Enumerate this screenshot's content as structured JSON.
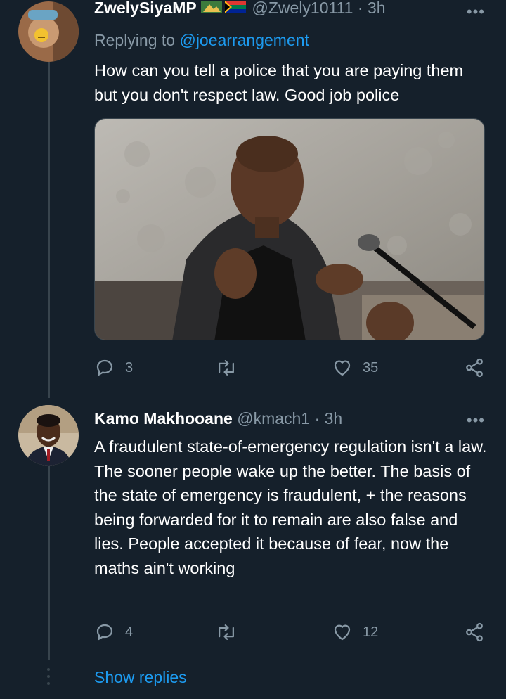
{
  "tweets": [
    {
      "display_name": "ZwelySiyaMP",
      "handle": "@Zwely10111",
      "time": "3h",
      "replying_prefix": "Replying to",
      "replying_to": "@joearrangement",
      "text": "How can you tell a police that you are paying them but you don't respect law. Good job police",
      "stats": {
        "replies": "3",
        "retweets": "",
        "likes": "35"
      }
    },
    {
      "display_name": "Kamo Makhooane",
      "handle": "@kmach1",
      "time": "3h",
      "text": "A fraudulent state-of-emergency regulation isn't a law. The sooner people wake up the better. The basis of the state of emergency is fraudulent, + the reasons being forwarded for it to remain are also false and lies. People accepted it because of fear, now the maths ain't working",
      "stats": {
        "replies": "4",
        "retweets": "",
        "likes": "12"
      }
    }
  ],
  "separator": "·",
  "more_glyph": "•••",
  "show_replies": "Show replies",
  "colors": {
    "background": "#15202b",
    "accent": "#1d9bf0",
    "muted": "#8899a6",
    "line": "#38444d"
  }
}
